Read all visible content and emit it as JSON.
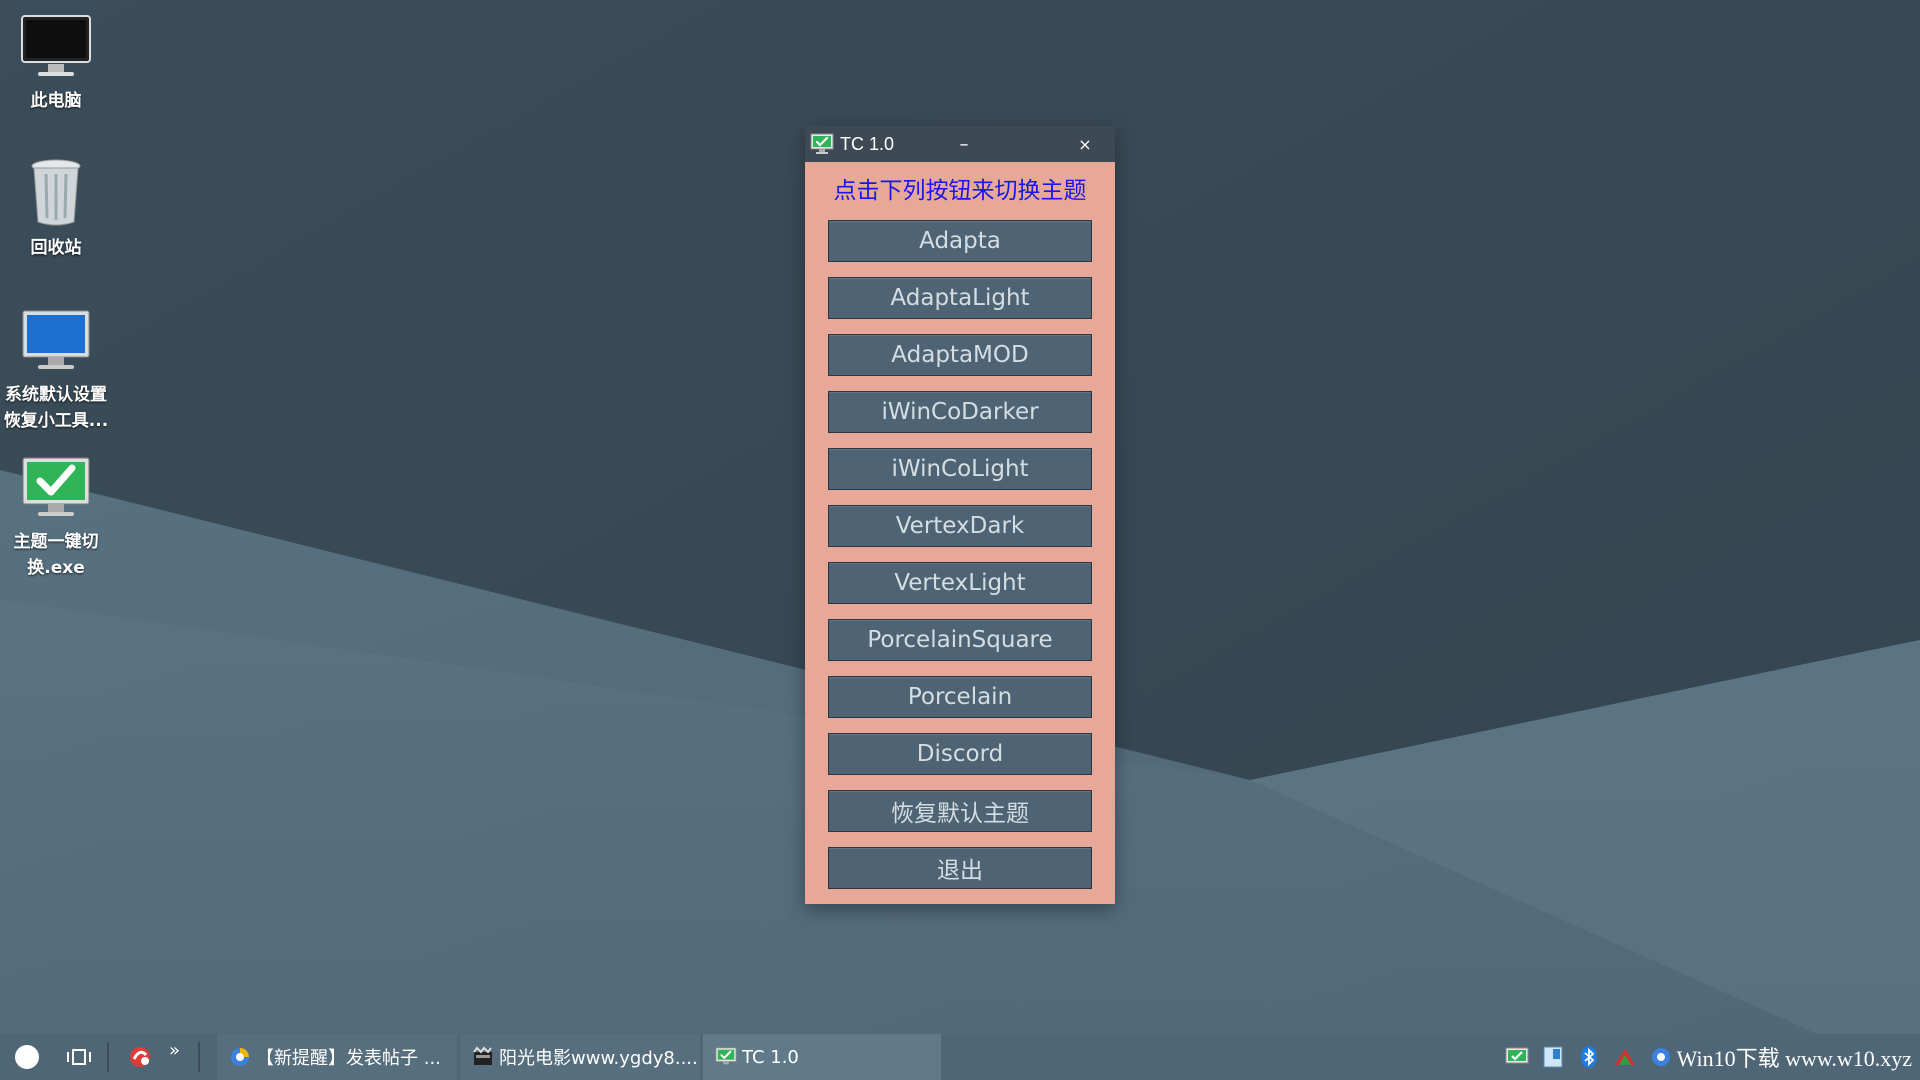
{
  "desktop": {
    "icons": [
      {
        "label": "此电脑",
        "icon": "monitor-icon"
      },
      {
        "label": "回收站",
        "icon": "recycle-bin-icon"
      },
      {
        "label": "系统默认设置\n恢复小工具...",
        "icon": "monitor-blue-icon"
      },
      {
        "label": "主题一键切\n换.exe",
        "icon": "checkmark-monitor-icon"
      }
    ]
  },
  "window": {
    "title": "TC 1.0",
    "minimize_glyph": "–",
    "close_glyph": "×",
    "heading": "点击下列按钮来切换主题",
    "buttons": [
      "Adapta",
      "AdaptaLight",
      "AdaptaMOD",
      "iWinCoDarker",
      "iWinCoLight",
      "VertexDark",
      "VertexLight",
      "PorcelainSquare",
      "Porcelain",
      "Discord",
      "恢复默认主题",
      "退出"
    ]
  },
  "taskbar": {
    "more_glyph": "»",
    "tasks": [
      {
        "label": "【新提醒】发表帖子 ...",
        "icon": "browser-icon"
      },
      {
        "label": "阳光电影www.ygdy8....",
        "icon": "video-player-icon"
      },
      {
        "label": "TC 1.0",
        "icon": "tc-app-icon"
      }
    ],
    "tray_brand": "Win10下载 www.w10.xyz"
  },
  "colors": {
    "window_bg": "#e8a898",
    "titlebar_bg": "#3d4a55",
    "button_bg": "#4e6474",
    "heading_text": "#1818e8",
    "taskbar_bg": "#4f6676",
    "active_task_bg": "#617a8a"
  }
}
